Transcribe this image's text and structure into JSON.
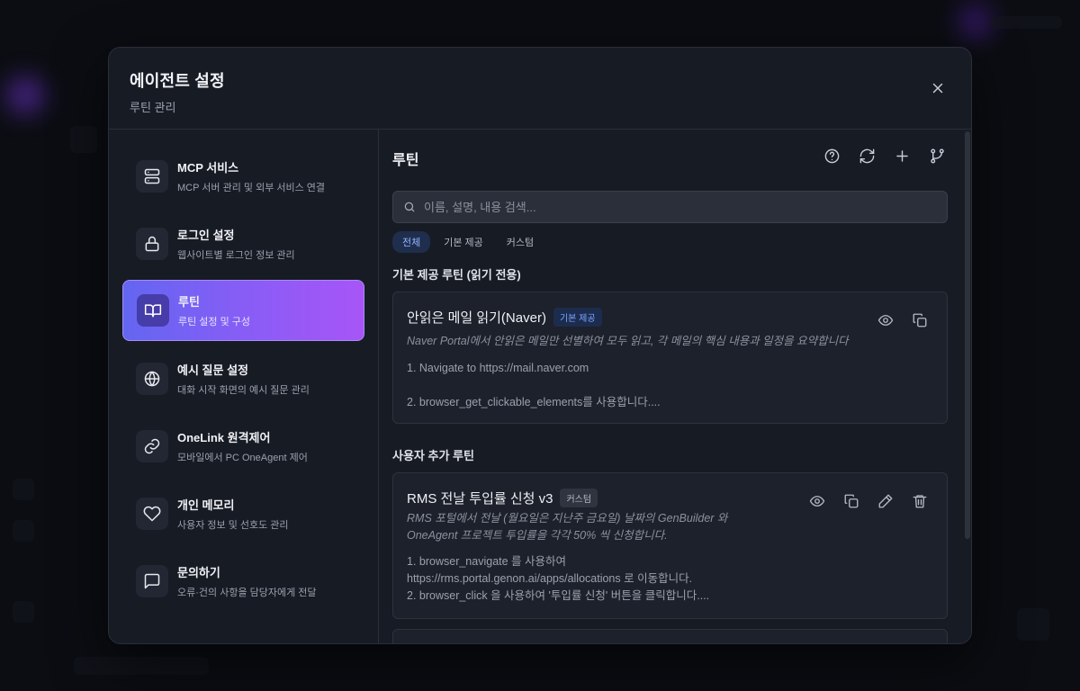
{
  "dialog": {
    "title": "에이전트 설정",
    "subtitle": "루틴 관리"
  },
  "sidebar": {
    "items": [
      {
        "label": "MCP 서비스",
        "desc": "MCP 서버 관리 및 외부 서비스 연결",
        "icon": "server-icon"
      },
      {
        "label": "로그인 설정",
        "desc": "웹사이트별 로그인 정보 관리",
        "icon": "lock-icon"
      },
      {
        "label": "루틴",
        "desc": "루틴 설정 및 구성",
        "icon": "book-icon",
        "active": true
      },
      {
        "label": "예시 질문 설정",
        "desc": "대화 시작 화면의 예시 질문 관리",
        "icon": "globe-icon"
      },
      {
        "label": "OneLink 원격제어",
        "desc": "모바일에서 PC OneAgent 제어",
        "icon": "link-icon"
      },
      {
        "label": "개인 메모리",
        "desc": "사용자 정보 및 선호도 관리",
        "icon": "heart-icon"
      },
      {
        "label": "문의하기",
        "desc": "오류·건의 사항을 담당자에게 전달",
        "icon": "message-icon"
      }
    ]
  },
  "main": {
    "title": "루틴",
    "search": {
      "placeholder": "이름, 설명, 내용 검색...",
      "value": ""
    },
    "filters": [
      {
        "label": "전체",
        "active": true
      },
      {
        "label": "기본 제공",
        "active": false
      },
      {
        "label": "커스텀",
        "active": false
      }
    ],
    "builtin_section": {
      "title": "기본 제공 루틴 (읽기 전용)",
      "cards": [
        {
          "title": "안읽은 메일 읽기(Naver)",
          "badge": "기본 제공",
          "desc": "Naver Portal에서 안읽은 메일만 선별하여 모두 읽고, 각 메일의 핵심 내용과 일정을 요약합니다",
          "body": "1. Navigate to https://mail.naver.com\n\n2. browser_get_clickable_elements를 사용합니다...."
        }
      ]
    },
    "custom_section": {
      "title": "사용자 추가 루틴",
      "cards": [
        {
          "title": "RMS 전날 투입률 신청 v3",
          "badge": "커스텀",
          "desc": "RMS 포털에서 전날 (월요일은 지난주 금요일) 날짜의 GenBuilder 와\nOneAgent 프로젝트 투입률을 각각 50% 씩 신청합니다.",
          "body": "1. browser_navigate 를 사용하여\nhttps://rms.portal.genon.ai/apps/allocations 로 이동합니다.\n2. browser_click 을 사용하여 '투입률 신청' 버튼을 클릭합니다...."
        }
      ]
    }
  },
  "colors": {
    "accent_start": "#6366f1",
    "accent_end": "#a855f7",
    "builtin_badge": "#7fa6ff",
    "modal_bg": "#171b24"
  }
}
